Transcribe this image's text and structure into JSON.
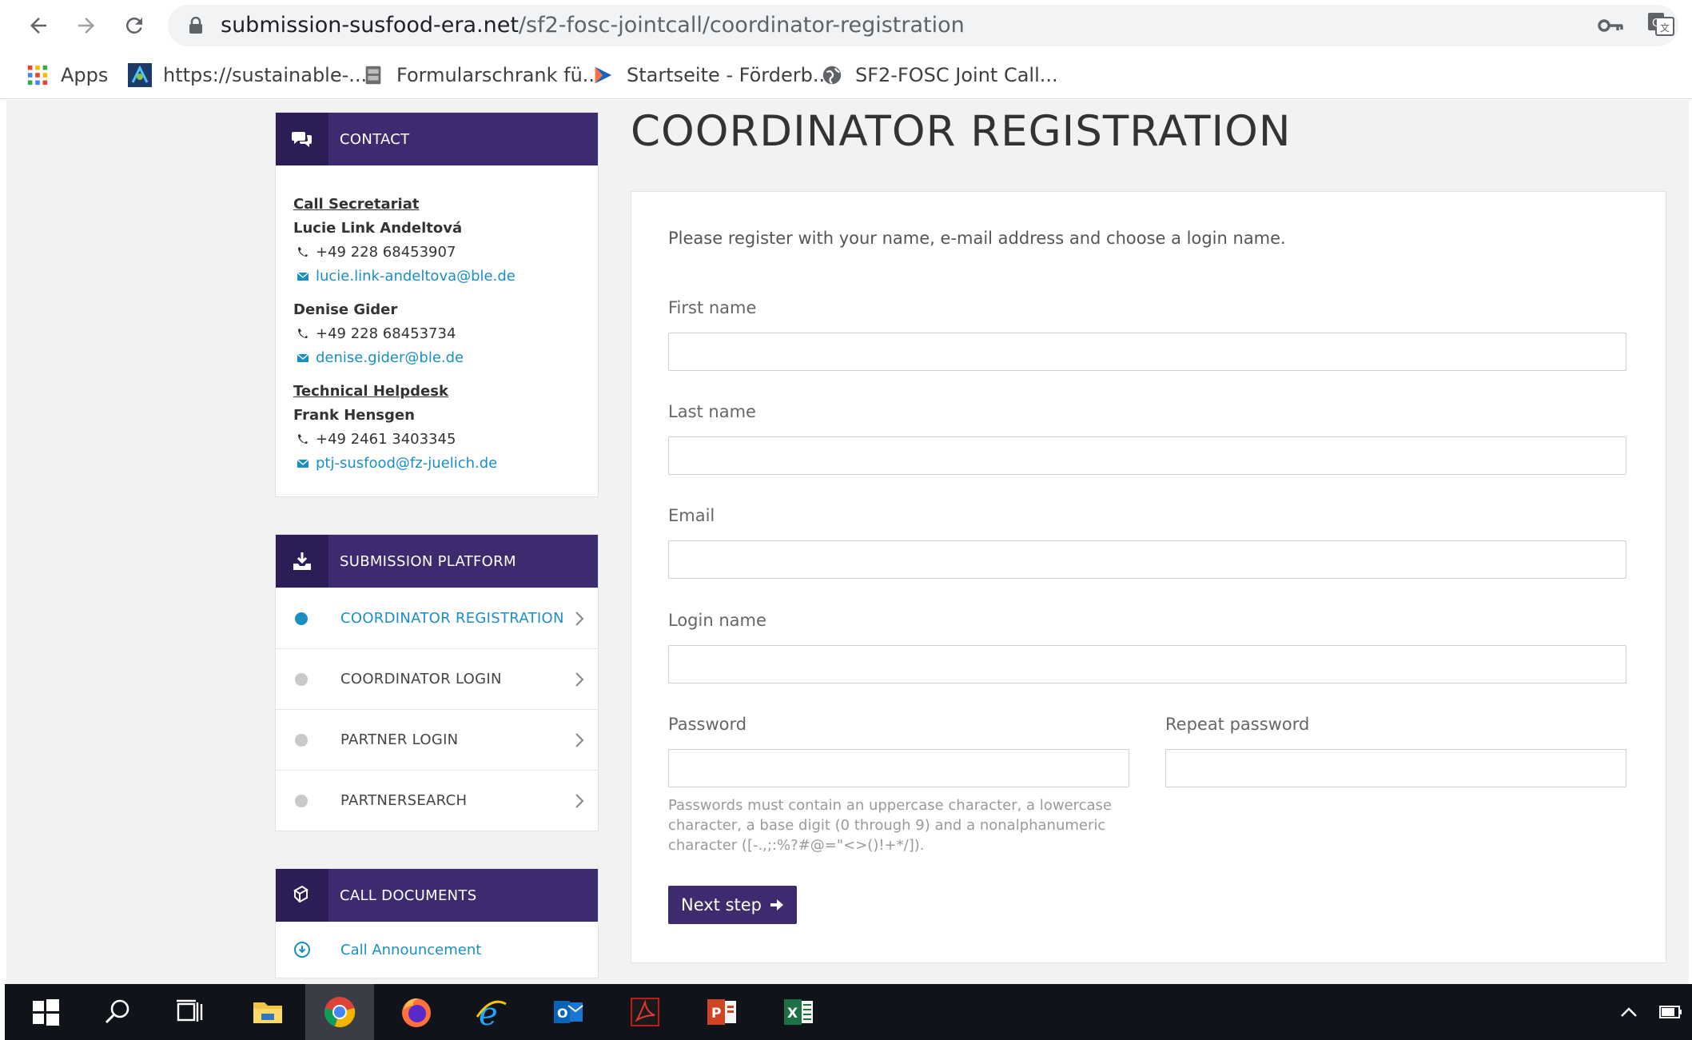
{
  "browser": {
    "url_host": "submission-susfood-era.net",
    "url_path": "/sf2-fosc-jointcall/coordinator-registration",
    "bookmarks": [
      {
        "label": "Apps",
        "icon": "apps-grid-icon"
      },
      {
        "label": "https://sustainable-...",
        "icon": "site-favicon-icon"
      },
      {
        "label": "Formularschrank fü...",
        "icon": "cabinet-favicon-icon"
      },
      {
        "label": "Startseite - Förderb...",
        "icon": "flag-favicon-icon"
      },
      {
        "label": "SF2-FOSC Joint Call...",
        "icon": "globe-favicon-icon"
      }
    ]
  },
  "sidebar": {
    "contact": {
      "title": "CONTACT",
      "call_secretariat": "Call Secretariat",
      "person1": {
        "name": "Lucie Link Andeltová",
        "phone": "+49 228 68453907",
        "email": "lucie.link-andeltova@ble.de"
      },
      "person2": {
        "name": "Denise Gider",
        "phone": "+49 228 68453734",
        "email": "denise.gider@ble.de"
      },
      "technical_helpdesk": "Technical Helpdesk",
      "person3": {
        "name": "Frank Hensgen",
        "phone": "+49 2461 3403345",
        "email": "ptj-susfood@fz-juelich.de"
      }
    },
    "submission": {
      "title": "SUBMISSION PLATFORM",
      "items": [
        {
          "label": "COORDINATOR REGISTRATION",
          "active": true
        },
        {
          "label": "COORDINATOR LOGIN",
          "active": false
        },
        {
          "label": "PARTNER LOGIN",
          "active": false
        },
        {
          "label": "PARTNERSEARCH",
          "active": false
        }
      ]
    },
    "documents": {
      "title": "CALL DOCUMENTS",
      "items": [
        {
          "label": "Call Announcement"
        }
      ]
    }
  },
  "main": {
    "title": "COORDINATOR REGISTRATION",
    "intro": "Please register with your name, e-mail address and choose a login name.",
    "fields": {
      "first_name": {
        "label": "First name",
        "value": ""
      },
      "last_name": {
        "label": "Last name",
        "value": ""
      },
      "email": {
        "label": "Email",
        "value": ""
      },
      "login_name": {
        "label": "Login name",
        "value": ""
      },
      "password": {
        "label": "Password",
        "value": ""
      },
      "repeat_password": {
        "label": "Repeat password",
        "value": ""
      }
    },
    "password_hint": "Passwords must contain an uppercase character, a lowercase character, a base digit (0 through 9) and a nonalphanumeric character ([-.,;:%?#@=\"<>()!+*/]).",
    "next_button": "Next step"
  },
  "colors": {
    "header_purple": "#3d2a6f",
    "header_icon_bg": "#2d1d57",
    "link_blue": "#1a8fc4",
    "page_bg": "#f2f2f2"
  }
}
